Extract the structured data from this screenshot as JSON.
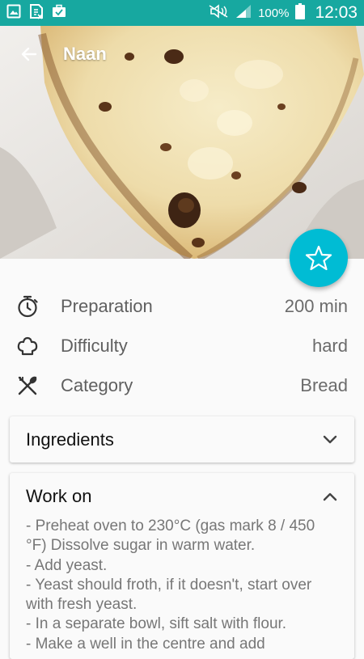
{
  "status_bar": {
    "battery_percent": "100%",
    "time": "12:03",
    "icons": [
      "gallery-icon",
      "sim-icon",
      "briefcase-icon",
      "mute-icon",
      "signal-icon",
      "battery-icon"
    ],
    "background": "#17a8a0"
  },
  "toolbar": {
    "title": "Naan",
    "back_icon": "arrow-left-icon"
  },
  "hero": {
    "image": "naan-bread-photo"
  },
  "fab": {
    "icon": "star-outline-icon",
    "color": "#00bcd4"
  },
  "details": [
    {
      "icon": "timer-icon",
      "label": "Preparation",
      "value": "200 min"
    },
    {
      "icon": "chef-hat-icon",
      "label": "Difficulty",
      "value": "hard"
    },
    {
      "icon": "utensils-icon",
      "label": "Category",
      "value": "Bread"
    }
  ],
  "ingredients_card": {
    "title": "Ingredients",
    "icon": "chevron-down-icon"
  },
  "work_card": {
    "title": "Work on",
    "icon": "chevron-up-icon",
    "steps": [
      "- Preheat oven to 230°C (gas mark 8 / 450 °F) Dissolve sugar in warm water.",
      "- Add yeast.",
      "- Yeast should froth, if it doesn't, start over with fresh yeast.",
      "- In a separate bowl, sift salt with flour.",
      "- Make a well in the centre and add"
    ]
  }
}
